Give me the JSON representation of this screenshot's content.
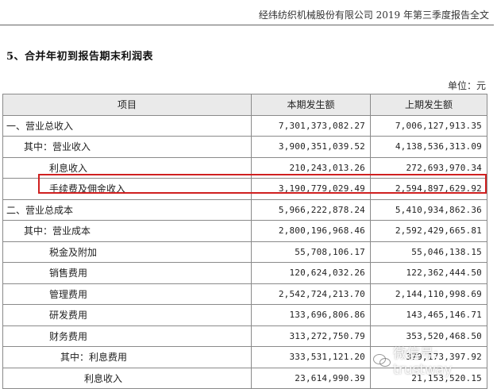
{
  "header": {
    "title": "经纬纺织机械股份有限公司 2019 年第三季度报告全文"
  },
  "section": {
    "title": "5、合并年初到报告期末利润表"
  },
  "unit": "单位：元",
  "table": {
    "columns": [
      "项目",
      "本期发生额",
      "上期发生额"
    ],
    "rows": [
      {
        "label": "一、营业总收入",
        "current": "7,301,373,082.27",
        "previous": "7,006,127,913.35"
      },
      {
        "label": "其中：营业收入",
        "current": "3,900,351,039.52",
        "previous": "4,138,536,313.09"
      },
      {
        "label": "利息收入",
        "current": "210,243,013.26",
        "previous": "272,693,970.34"
      },
      {
        "label": "手续费及佣金收入",
        "current": "3,190,779,029.49",
        "previous": "2,594,897,629.92"
      },
      {
        "label": "二、营业总成本",
        "current": "5,966,222,878.24",
        "previous": "5,410,934,862.36"
      },
      {
        "label": "其中：营业成本",
        "current": "2,800,196,968.46",
        "previous": "2,592,429,665.81"
      },
      {
        "label": "税金及附加",
        "current": "55,708,106.17",
        "previous": "55,046,138.15"
      },
      {
        "label": "销售费用",
        "current": "120,624,032.26",
        "previous": "122,362,444.50"
      },
      {
        "label": "管理费用",
        "current": "2,542,724,213.70",
        "previous": "2,144,110,998.69"
      },
      {
        "label": "研发费用",
        "current": "133,696,806.86",
        "previous": "143,465,146.71"
      },
      {
        "label": "财务费用",
        "current": "313,272,750.79",
        "previous": "353,520,468.50"
      },
      {
        "label": "其中：利息费用",
        "current": "333,531,121.20",
        "previous": "379,173,397.92"
      },
      {
        "label": "利息收入",
        "current": "23,614,990.39",
        "previous": "21,153,520.15"
      }
    ]
  },
  "watermark": {
    "text": "微信号: trustway"
  },
  "colors": {
    "highlight": "#d02020",
    "header_bg": "#eaeaea",
    "border": "#8a8a8a"
  }
}
